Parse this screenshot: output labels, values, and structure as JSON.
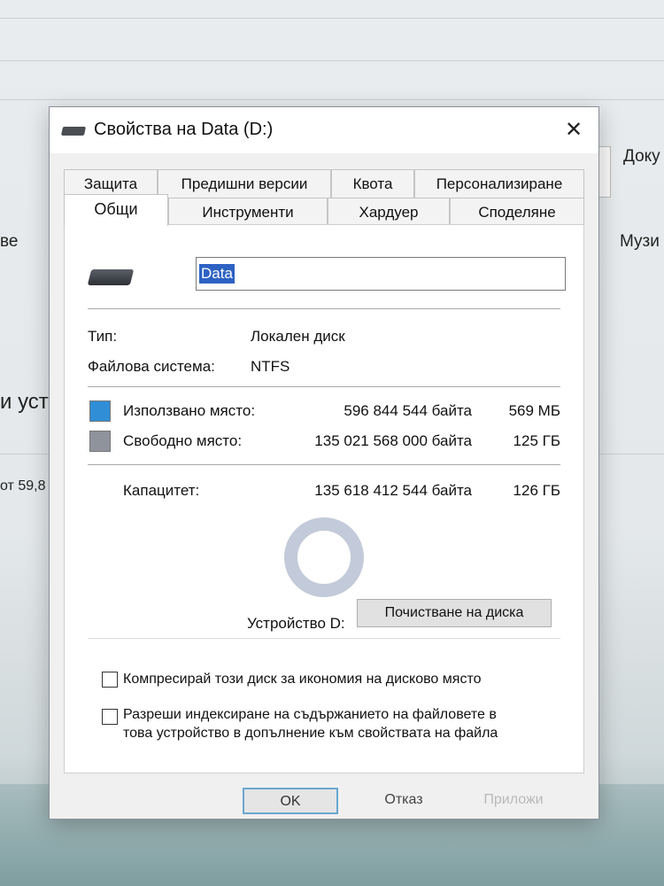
{
  "background": {
    "label_docs": "Доку",
    "label_music": "Музи",
    "label_left_ve": "ве",
    "label_devices": "и уст",
    "label_free_of": "от 59,8"
  },
  "dialog": {
    "title": "Свойства на Data (D:)",
    "close_glyph": "✕",
    "tabs_row1": [
      "Защита",
      "Предишни версии",
      "Квота",
      "Персонализиране"
    ],
    "tabs_row2": [
      "Общи",
      "Инструменти",
      "Хардуер",
      "Споделяне"
    ],
    "volume_name": "Data",
    "type_label": "Тип:",
    "type_value": "Локален диск",
    "fs_label": "Файлова система:",
    "fs_value": "NTFS",
    "used_label": "Използвано място:",
    "used_bytes": "596 844 544 байта",
    "used_human": "569 МБ",
    "free_label": "Свободно място:",
    "free_bytes": "135 021 568 000 байта",
    "free_human": "125 ГБ",
    "capacity_label": "Капацитет:",
    "capacity_bytes": "135 618 412 544 байта",
    "capacity_human": "126 ГБ",
    "drive_label": "Устройство D:",
    "cleanup_button": "Почистване на диска",
    "compress_label": "Компресирай този диск за икономия на дисково място",
    "index_label_line1": "Разреши индексиране на съдържанието на файловете в",
    "index_label_line2": "това устройство в допълнение към свойствата на файла",
    "ok": "OK",
    "cancel": "Отказ",
    "apply": "Приложи",
    "used_fraction": 0.0044
  },
  "colors": {
    "used": "#2f8ed6",
    "free": "#8f939c",
    "selection": "#2d62c3"
  }
}
